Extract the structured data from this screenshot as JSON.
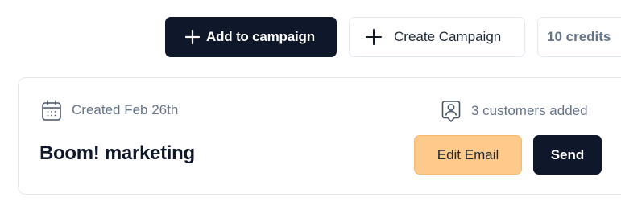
{
  "toolbar": {
    "add_to_campaign_label": "Add to campaign",
    "create_campaign_label": "Create Campaign",
    "credits_label": "10 credits"
  },
  "campaign": {
    "created_text": "Created Feb 26th",
    "customers_text": "3 customers added",
    "name": "Boom! marketing",
    "edit_email_label": "Edit Email",
    "send_label": "Send"
  },
  "icons": {
    "plus": "plus-icon",
    "calendar": "calendar-icon",
    "customers": "user-badge-icon"
  },
  "colors": {
    "primary_dark": "#0f172a",
    "accent_orange": "#fdca8b",
    "muted_text": "#64748b",
    "border": "#e2e8f0"
  }
}
